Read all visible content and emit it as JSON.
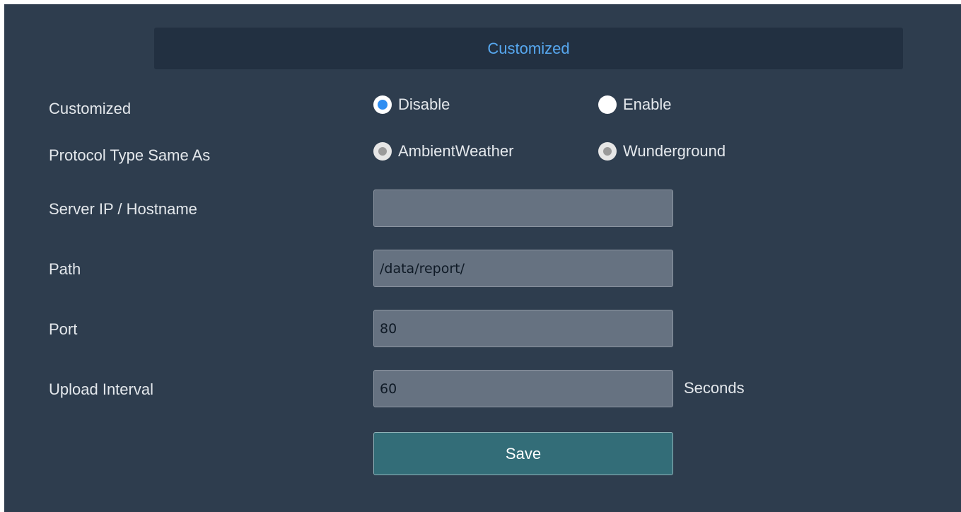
{
  "section": {
    "title": "Customized"
  },
  "form": {
    "customized": {
      "label": "Customized",
      "options": [
        {
          "label": "Disable",
          "selected": true
        },
        {
          "label": "Enable",
          "selected": false
        }
      ]
    },
    "protocol": {
      "label": "Protocol Type Same As",
      "disabled": true,
      "options": [
        {
          "label": "AmbientWeather",
          "selected": false
        },
        {
          "label": "Wunderground",
          "selected": false
        }
      ]
    },
    "server": {
      "label": "Server IP / Hostname",
      "value": ""
    },
    "path": {
      "label": "Path",
      "value": "/data/report/"
    },
    "port": {
      "label": "Port",
      "value": "80"
    },
    "interval": {
      "label": "Upload Interval",
      "value": "60",
      "unit": "Seconds"
    },
    "save_label": "Save"
  },
  "colors": {
    "panel_bg": "#2e3d4e",
    "title_bar_bg": "#223041",
    "title_text": "#57a8f0",
    "radio_accent": "#2f8ef2",
    "input_bg": "#667281",
    "save_button_bg": "#336d78"
  }
}
